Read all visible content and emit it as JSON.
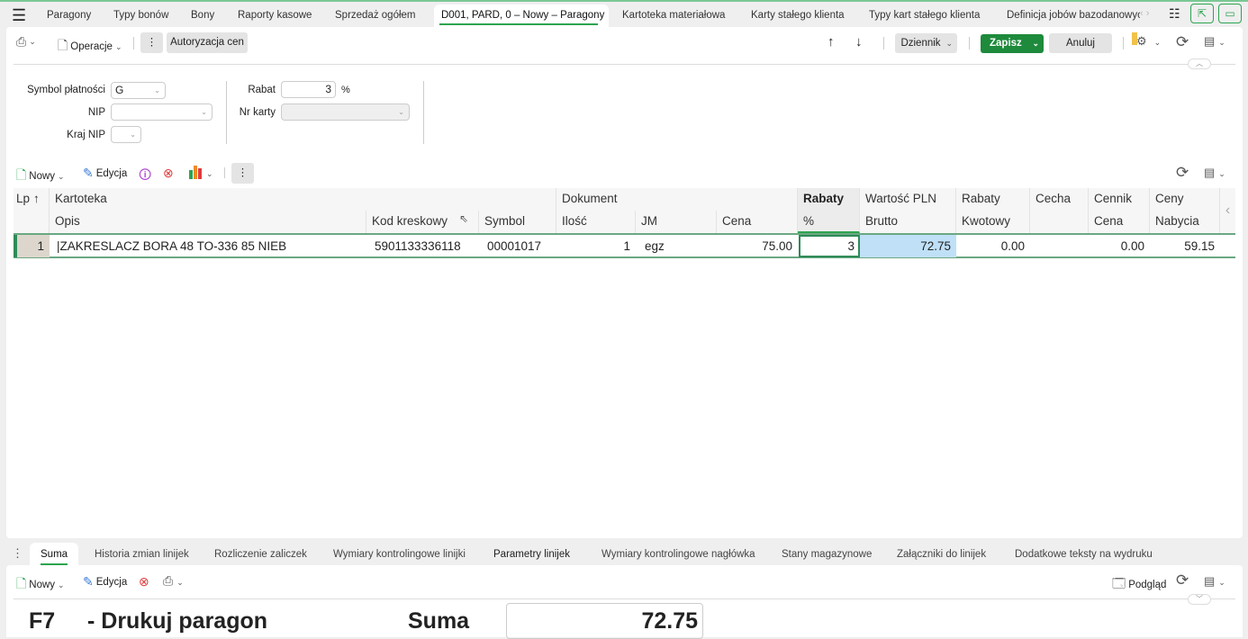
{
  "tabs": [
    {
      "label": "Paragony"
    },
    {
      "label": "Typy bonów"
    },
    {
      "label": "Bony"
    },
    {
      "label": "Raporty kasowe"
    },
    {
      "label": "Sprzedaż ogółem"
    },
    {
      "label": "D001, PARD, 0 – Nowy – Paragony",
      "active": true
    },
    {
      "label": "Kartoteka materiałowa"
    },
    {
      "label": "Karty stałego klienta"
    },
    {
      "label": "Typy kart stałego klienta"
    },
    {
      "label": "Definicja jobów bazodanowych"
    }
  ],
  "toolbar": {
    "operacje": "Operacje",
    "autoryzacja": "Autoryzacja cen",
    "dziennik": "Dziennik",
    "zapisz": "Zapisz",
    "anuluj": "Anuluj"
  },
  "form": {
    "symbol_platnosci_label": "Symbol płatności",
    "symbol_platnosci_value": "G",
    "nip_label": "NIP",
    "nip_value": "",
    "kraj_nip_label": "Kraj NIP",
    "kraj_nip_value": "",
    "rabat_label": "Rabat",
    "rabat_value": "3",
    "rabat_unit": "%",
    "nr_karty_label": "Nr karty",
    "nr_karty_value": ""
  },
  "grid_toolbar": {
    "nowy": "Nowy",
    "edycja": "Edycja"
  },
  "grid": {
    "groups": {
      "lp": "Lp",
      "kartoteka": "Kartoteka",
      "dokument": "Dokument",
      "rabaty": "Rabaty",
      "wartosc": "Wartość PLN",
      "rabaty2": "Rabaty",
      "cecha": "Cecha",
      "cennik": "Cennik",
      "ceny": "Ceny"
    },
    "columns": {
      "opis": "Opis",
      "kod": "Kod kreskowy",
      "symbol": "Symbol",
      "ilosc": "Ilość",
      "jm": "JM",
      "cena": "Cena",
      "procent": "%",
      "brutto": "Brutto",
      "kwotowy": "Kwotowy",
      "cennik_cena": "Cena",
      "nabycia": "Nabycia"
    },
    "rows": [
      {
        "lp": "1",
        "opis": "|ZAKRESLACZ BORA 48 TO-336 85 NIEB",
        "kod": "5901133336118",
        "symbol": "00001017",
        "ilosc": "1",
        "jm": "egz",
        "cena": "75.00",
        "procent": "3",
        "brutto": "72.75",
        "kwotowy": "0.00",
        "cecha": "",
        "cennik_cena": "0.00",
        "nabycia": "59.15"
      }
    ]
  },
  "bottom_tabs": [
    {
      "label": "Suma",
      "active": true
    },
    {
      "label": "Historia zmian linijek"
    },
    {
      "label": "Rozliczenie zaliczek"
    },
    {
      "label": "Wymiary kontrolingowe linijki"
    },
    {
      "label": "Parametry linijek"
    },
    {
      "label": "Wymiary kontrolingowe nagłówka"
    },
    {
      "label": "Stany magazynowe"
    },
    {
      "label": "Załączniki do linijek"
    },
    {
      "label": "Dodatkowe teksty na wydruku"
    }
  ],
  "bottom_toolbar": {
    "nowy": "Nowy",
    "edycja": "Edycja",
    "podglad": "Podgląd"
  },
  "summary": {
    "hint_key": "F7",
    "hint_text": "- Drukuj paragon",
    "suma_label": "Suma",
    "suma_value": "72.75"
  },
  "colors": {
    "accent": "#1e8a3c",
    "selected_cell": "#bfe0f7"
  }
}
